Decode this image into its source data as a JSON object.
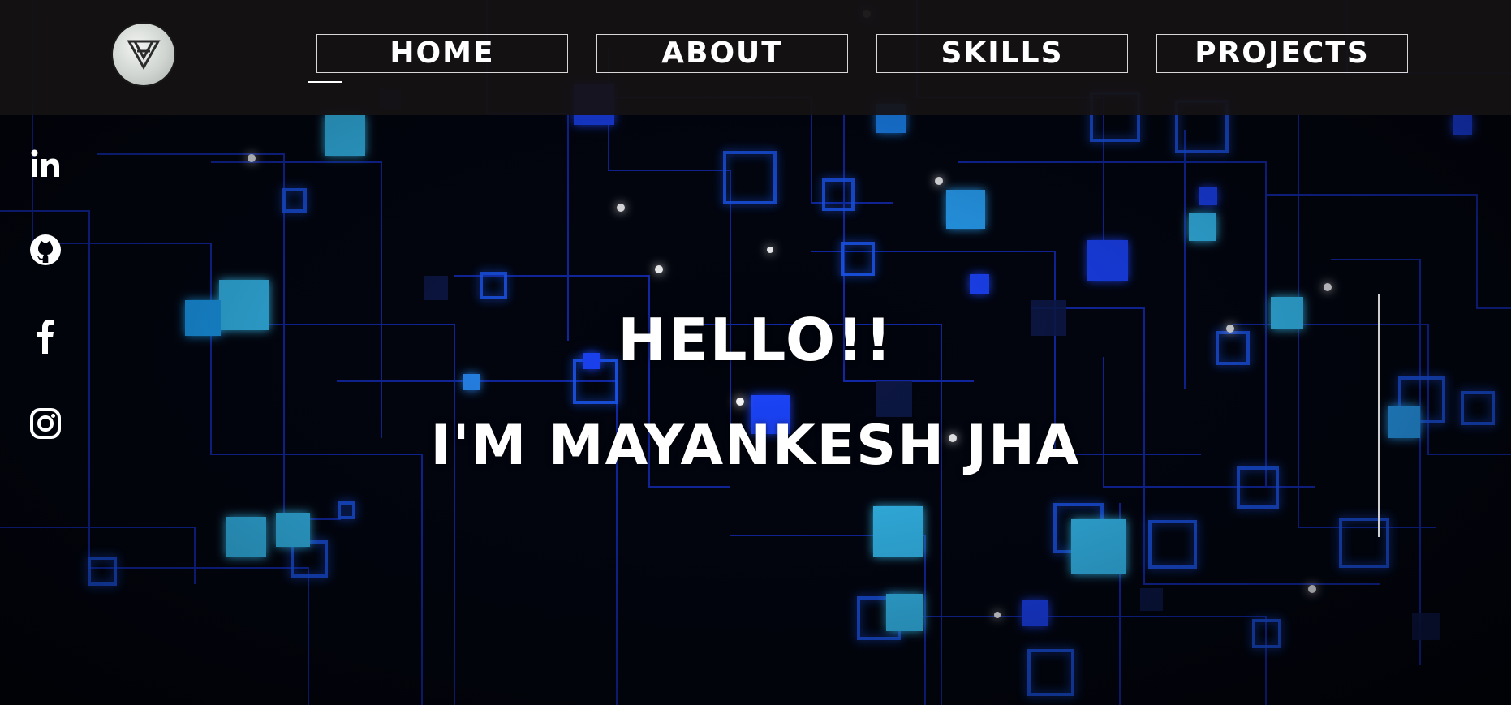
{
  "nav": {
    "items": [
      {
        "label": "HOME"
      },
      {
        "label": "ABOUT"
      },
      {
        "label": "SKILLS"
      },
      {
        "label": "PROJECTS"
      }
    ],
    "active": "HOME"
  },
  "social": {
    "icons": [
      "linkedin-icon",
      "github-icon",
      "facebook-icon",
      "instagram-icon"
    ]
  },
  "hero": {
    "greeting": "HELLO!!",
    "name": "I'M MAYANKESH JHA"
  },
  "colors": {
    "background": "#02030a",
    "topbar": "#161214",
    "accent_blue": "#1c3cff",
    "glow_cyan": "#33c6ff",
    "text": "#ffffff"
  }
}
